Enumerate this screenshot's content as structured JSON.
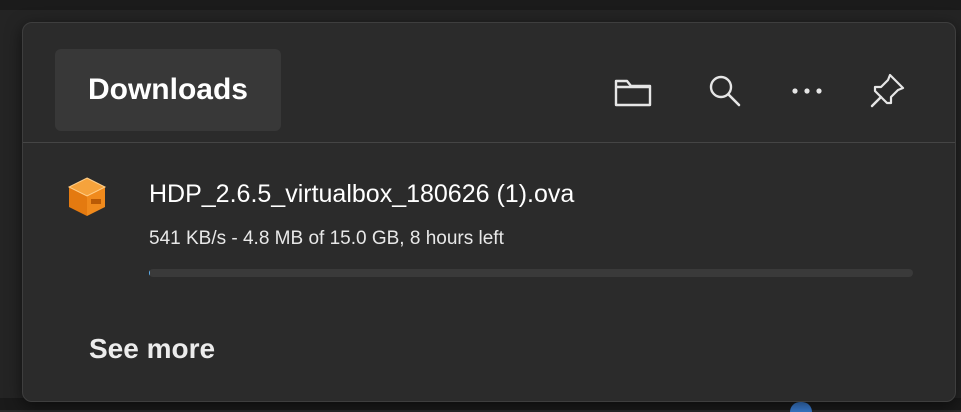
{
  "downloads_panel": {
    "title": "Downloads",
    "header_icons": [
      "open-folder-icon",
      "search-icon",
      "more-options-icon",
      "pin-icon"
    ],
    "items": [
      {
        "file_name": "HDP_2.6.5_virtualbox_180626 (1).ova",
        "status": "541 KB/s - 4.8 MB of 15.0 GB, 8 hours left",
        "progress_fraction": 0.0003,
        "icon": "ova-file-icon"
      }
    ],
    "see_more_label": "See more"
  },
  "colors": {
    "panel_bg": "#2b2b2b",
    "title_box_bg": "#383838",
    "progress_fill": "#5fb2f2",
    "text_primary": "#ffffff"
  }
}
